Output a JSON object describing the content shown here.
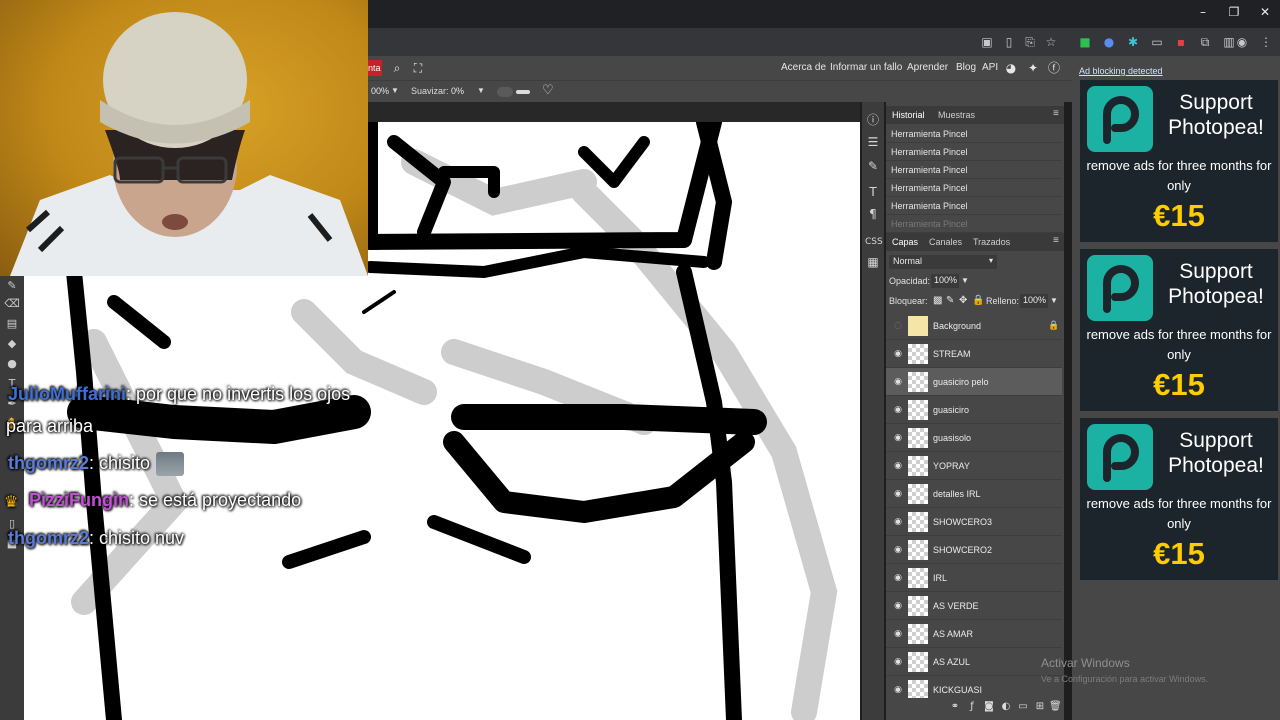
{
  "photopea": {
    "menu_links": [
      "Acerca de",
      "Informar un fallo",
      "Aprender",
      "Blog",
      "API"
    ],
    "partial_button": "nta",
    "options": {
      "zoom_partial": "00%",
      "smooth_label": "Suavizar:",
      "smooth_value": "0%"
    },
    "history": {
      "tabs": [
        "Historial",
        "Muestras"
      ],
      "items": [
        "Herramienta Pincel",
        "Herramienta Pincel",
        "Herramienta Pincel",
        "Herramienta Pincel",
        "Herramienta Pincel",
        "Herramienta Pincel"
      ]
    },
    "layers": {
      "tabs": [
        "Capas",
        "Canales",
        "Trazados"
      ],
      "blend_mode": "Normal",
      "opacity_label": "Opacidad:",
      "opacity_value": "100%",
      "lock_label": "Bloquear:",
      "fill_label": "Relleno:",
      "fill_value": "100%",
      "items": [
        {
          "name": "Background"
        },
        {
          "name": "STREAM"
        },
        {
          "name": "guasiciro pelo"
        },
        {
          "name": "guasiciro"
        },
        {
          "name": "guasisolo"
        },
        {
          "name": "YOPRAY"
        },
        {
          "name": "detalles IRL"
        },
        {
          "name": "SHOWCERO3"
        },
        {
          "name": "SHOWCERO2"
        },
        {
          "name": "IRL"
        },
        {
          "name": "AS VERDE"
        },
        {
          "name": "AS AMAR"
        },
        {
          "name": "AS AZUL"
        },
        {
          "name": "KICKGUASI"
        }
      ]
    }
  },
  "ads": {
    "warning": "Ad blocking detected",
    "title": "Support Photopea!",
    "subtitle": "remove ads for three months for only",
    "price": "€15"
  },
  "chat": [
    {
      "user": "JulioMuffarini",
      "text": ": por que no invertis los ojos",
      "continuation": "para arriba",
      "color": "#3d6fd6"
    },
    {
      "user": "thgomrz2",
      "text": ": chisito",
      "color": "#5a7bd8"
    },
    {
      "user": "PizziFungin",
      "text": ": se está proyectando",
      "color": "#c24fd6"
    },
    {
      "user": "thgomrz2",
      "text": ": chisito nuv",
      "color": "#5a7bd8"
    }
  ],
  "windows_watermark": {
    "title": "Activar Windows",
    "subtitle": "Ve a Configuración para activar Windows."
  },
  "colors": {
    "ad_price": "#ffcc00",
    "photopea_teal": "#1bb1a3",
    "panel_bg": "#474747"
  }
}
